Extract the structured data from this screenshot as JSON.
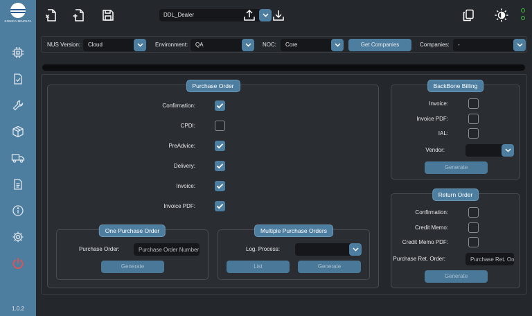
{
  "app": {
    "logo_text": "KONICA MINOLTA",
    "version": "1.0.2",
    "accent_color": "#4d7ea0",
    "status_color": "#40c040"
  },
  "sidebar": {
    "items": [
      {
        "name": "chip-icon"
      },
      {
        "name": "checklist-icon"
      },
      {
        "name": "wrench-icon"
      },
      {
        "name": "box-icon"
      },
      {
        "name": "truck-icon"
      },
      {
        "name": "document-icon"
      },
      {
        "name": "info-icon"
      },
      {
        "name": "gear-icon"
      },
      {
        "name": "power-icon"
      }
    ]
  },
  "toolbar": {
    "file_value": "DDL_Dealer",
    "icons": [
      "close-file-icon",
      "new-file-icon",
      "save-icon",
      "upload-icon",
      "download-icon",
      "copy-icon",
      "theme-icon"
    ]
  },
  "filters": {
    "nus_label": "NUS Version:",
    "nus_value": "Cloud",
    "env_label": "Environment:",
    "env_value": "QA",
    "noc_label": "NOC:",
    "noc_value": "Core",
    "get_companies": "Get Companies",
    "companies_label": "Companies:",
    "companies_value": "-"
  },
  "purchase_order": {
    "title": "Purchase Order",
    "rows": [
      {
        "label": "Confirmation:",
        "checked": true
      },
      {
        "label": "CPDI:",
        "checked": false
      },
      {
        "label": "PreAdvice:",
        "checked": true
      },
      {
        "label": "Delivery:",
        "checked": true
      },
      {
        "label": "Invoice:",
        "checked": true
      },
      {
        "label": "Invoice PDF:",
        "checked": true
      }
    ],
    "one": {
      "title": "One Purchase Order",
      "label": "Purchase Order:",
      "placeholder": "Purchase Order Number",
      "generate": "Generate"
    },
    "multiple": {
      "title": "Multiple Purchase Orders",
      "label": "Log. Process:",
      "value": "",
      "list": "List",
      "generate": "Generate"
    }
  },
  "backbone": {
    "title": "BackBone Billing",
    "rows": [
      {
        "label": "Invoice:",
        "checked": false
      },
      {
        "label": "Invoice PDF:",
        "checked": false
      },
      {
        "label": "IAL:",
        "checked": false
      }
    ],
    "vendor_label": "Vendor:",
    "vendor_value": "",
    "generate": "Generate"
  },
  "return_order": {
    "title": "Return Order",
    "rows": [
      {
        "label": "Confirmation:",
        "checked": false
      },
      {
        "label": "Credit Memo:",
        "checked": false
      },
      {
        "label": "Credit Memo PDF:",
        "checked": false
      }
    ],
    "ret_label": "Purchase Ret. Order:",
    "ret_placeholder": "Purchase Ret. Order",
    "generate": "Generate"
  }
}
